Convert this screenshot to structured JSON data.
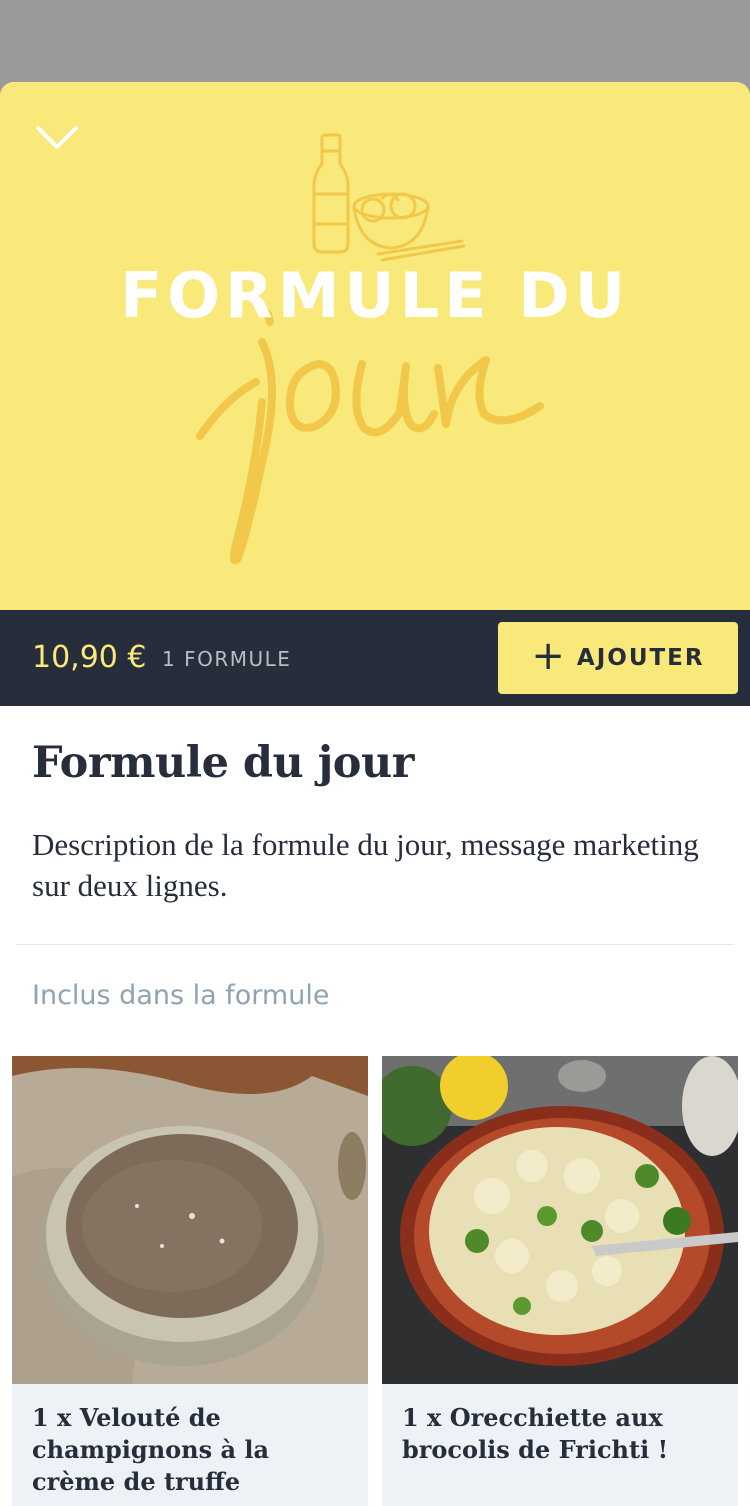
{
  "hero": {
    "title_line": "FORMULE DU",
    "script_word": "jour",
    "background_color": "#f8e97a",
    "icons": [
      "chevron-down-icon",
      "bottle-icon",
      "bowl-icon"
    ]
  },
  "purchase_bar": {
    "price": "10,90 €",
    "quantity_label": "1 FORMULE",
    "add_button_label": "AJOUTER"
  },
  "product": {
    "title": "Formule du jour",
    "description": "Description de la formule du jour, message marketing sur deux lignes."
  },
  "included": {
    "section_label": "Inclus dans la formule",
    "items": [
      {
        "name": "1 x Velouté de champignons à la crème de truffe"
      },
      {
        "name": "1 x Orecchiette aux brocolis de Frichti !"
      }
    ]
  },
  "colors": {
    "accent_yellow": "#f8e97a",
    "dark_navy": "#262d3b",
    "muted_blue": "#8fa3b3",
    "card_background": "#eef2f7"
  }
}
